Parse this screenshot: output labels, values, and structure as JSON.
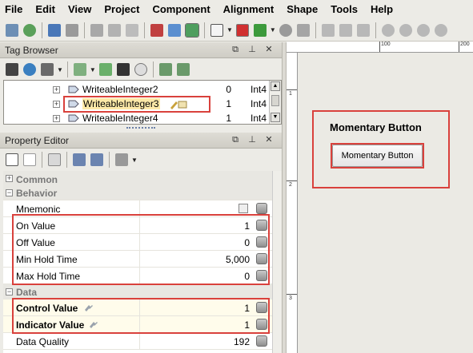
{
  "menu": [
    "File",
    "Edit",
    "View",
    "Project",
    "Component",
    "Alignment",
    "Shape",
    "Tools",
    "Help"
  ],
  "tag_browser": {
    "title": "Tag Browser",
    "rows": [
      {
        "name": "WriteableInteger2",
        "value": "0",
        "type": "Int4"
      },
      {
        "name": "WriteableInteger3",
        "value": "1",
        "type": "Int4"
      },
      {
        "name": "WriteableInteger4",
        "value": "1",
        "type": "Int4"
      }
    ]
  },
  "property_editor": {
    "title": "Property Editor",
    "sections": {
      "common": "Common",
      "behavior": "Behavior",
      "data": "Data"
    },
    "rows": {
      "mnemonic": {
        "label": "Mnemonic",
        "value": ""
      },
      "on_value": {
        "label": "On Value",
        "value": "1"
      },
      "off_value": {
        "label": "Off Value",
        "value": "0"
      },
      "min_hold": {
        "label": "Min Hold Time",
        "value": "5,000"
      },
      "max_hold": {
        "label": "Max Hold Time",
        "value": "0"
      },
      "control_value": {
        "label": "Control Value",
        "value": "1"
      },
      "indicator_value": {
        "label": "Indicator Value",
        "value": "1"
      },
      "data_quality": {
        "label": "Data Quality",
        "value": "192"
      }
    }
  },
  "designer": {
    "component_title": "Momentary Button",
    "button_label": "Momentary Button",
    "ruler_top": [
      "100",
      "200"
    ],
    "ruler_left": [
      "1",
      "2",
      "3"
    ]
  },
  "colors": {
    "annotation": "#d9413c",
    "highlight": "#fde9a8"
  }
}
